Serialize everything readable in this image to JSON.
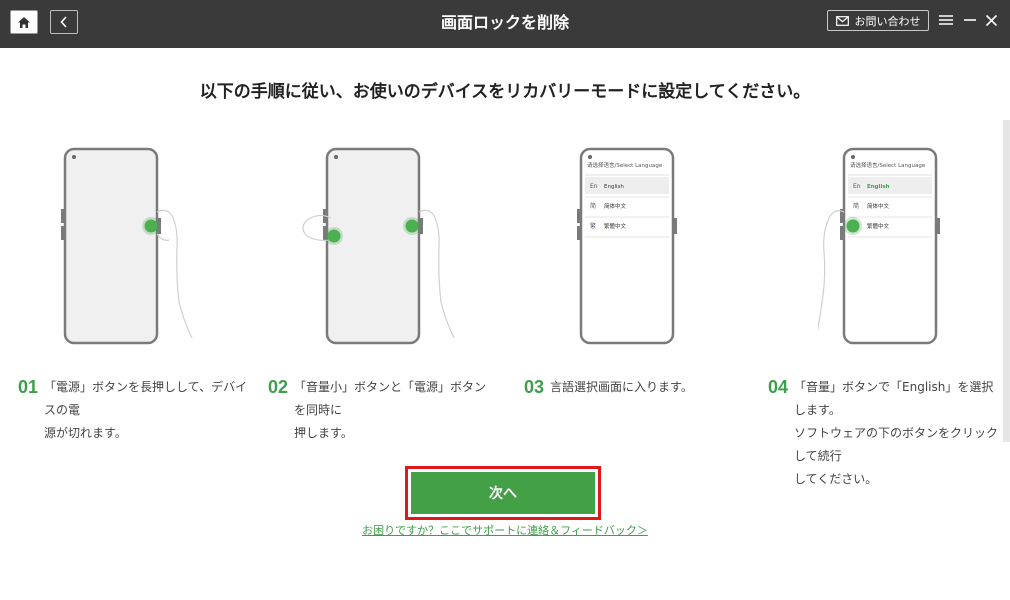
{
  "window": {
    "title": "画面ロックを削除",
    "contact_label": "お問い合わせ",
    "icons": [
      "home-icon",
      "back-icon",
      "mail-icon",
      "menu-icon",
      "minimize-icon",
      "close-icon"
    ]
  },
  "headline": "以下の手順に従い、お使いのデバイスをリカバリーモードに設定してください。",
  "language_screen": {
    "header": "请选择语言/Select Language",
    "options": [
      {
        "code": "En",
        "label": "English"
      },
      {
        "code": "简",
        "label": "简体中文"
      },
      {
        "code": "繁",
        "label": "繁體中文"
      }
    ]
  },
  "steps": [
    {
      "num": "01",
      "lines": [
        "「電源」ボタンを長押しして、デバイスの電",
        "源が切れます。"
      ]
    },
    {
      "num": "02",
      "lines": [
        "「音量小」ボタンと「電源」ボタンを同時に",
        "押します。"
      ]
    },
    {
      "num": "03",
      "lines": [
        "言語選択画面に入ります。"
      ]
    },
    {
      "num": "04",
      "lines": [
        "「音量」ボタンで「English」を選択します。",
        "ソフトウェアの下のボタンをクリックして続行",
        "してください。"
      ]
    }
  ],
  "next_button": "次へ",
  "help_link": "お困りですか？ここでサポートに連絡＆フィードバック＞",
  "colors": {
    "accent": "#43a047",
    "titlebar": "#3a3a3a",
    "highlight": "#e01818"
  }
}
